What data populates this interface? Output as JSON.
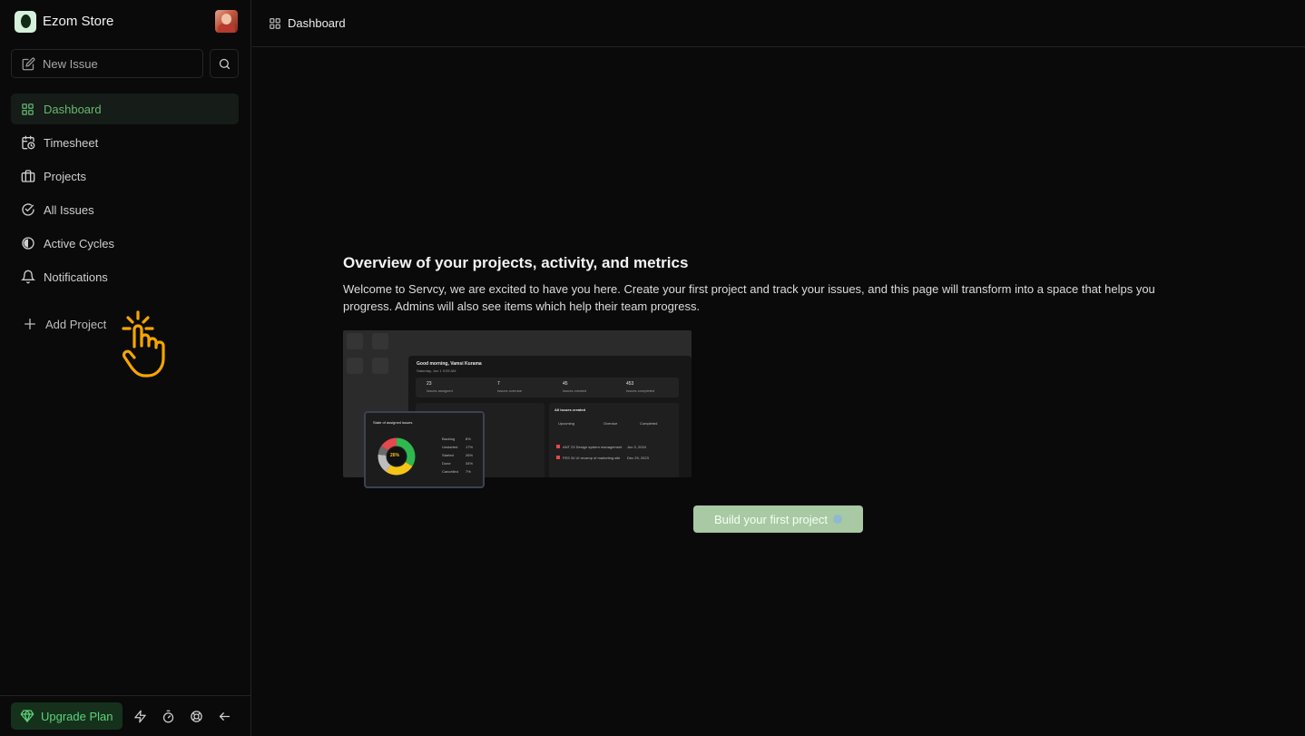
{
  "workspace": {
    "name": "Ezom Store"
  },
  "sidebar": {
    "new_issue_label": "New Issue",
    "items": [
      {
        "label": "Dashboard",
        "icon": "grid-icon",
        "active": true
      },
      {
        "label": "Timesheet",
        "icon": "calendar-clock-icon"
      },
      {
        "label": "Projects",
        "icon": "briefcase-icon"
      },
      {
        "label": "All Issues",
        "icon": "check-circle-icon"
      },
      {
        "label": "Active Cycles",
        "icon": "contrast-icon"
      },
      {
        "label": "Notifications",
        "icon": "bell-icon"
      }
    ],
    "add_project_label": "Add Project",
    "upgrade_label": "Upgrade Plan"
  },
  "topbar": {
    "title": "Dashboard"
  },
  "main": {
    "heading": "Overview of your projects, activity, and metrics",
    "description": "Welcome to Servcy, we are excited to have you here. Create your first project and track your issues, and this page will transform into a space that helps you progress. Admins will also see items which help their team progress.",
    "cta_label": "Build your first project"
  },
  "preview": {
    "greeting": "Good morning, Vamsi Kurama",
    "date": "Saturday, Jun 1  9:05 AM",
    "stats": [
      {
        "value": "23",
        "label": "Issues assigned"
      },
      {
        "value": "7",
        "label": "Issues overdue"
      },
      {
        "value": "45",
        "label": "Issues created"
      },
      {
        "value": "453",
        "label": "Issues completed"
      }
    ],
    "right_title": "All issues created",
    "right_tabs": [
      "Upcoming",
      "Overdue",
      "Completed"
    ],
    "right_rows": [
      {
        "id": "ANT 23",
        "title": "Design system management",
        "date": "Jun 3, 2024"
      },
      {
        "id": "FES 34",
        "title": "UI revamp of marketing site",
        "date": "Dec 29, 2023"
      }
    ],
    "donut_title": "State of assigned issues",
    "donut_center": "26%",
    "donut_legend": [
      {
        "label": "Backlog",
        "value": "8%"
      },
      {
        "label": "Unstarted",
        "value": "17%"
      },
      {
        "label": "Started",
        "value": "26%"
      },
      {
        "label": "Done",
        "value": "34%"
      },
      {
        "label": "Cancelled",
        "value": "7%"
      }
    ],
    "colors": {
      "backlog": "#bdbdbd",
      "unstarted": "#6b6b6b",
      "started": "#f5c518",
      "done": "#2fb84f",
      "cancelled": "#e5484d"
    }
  },
  "colors": {
    "accent": "#63b96f",
    "upgrade_text": "#5fd17a",
    "cta_bg": "#a8c9a3",
    "pointer": "#f6a500"
  }
}
